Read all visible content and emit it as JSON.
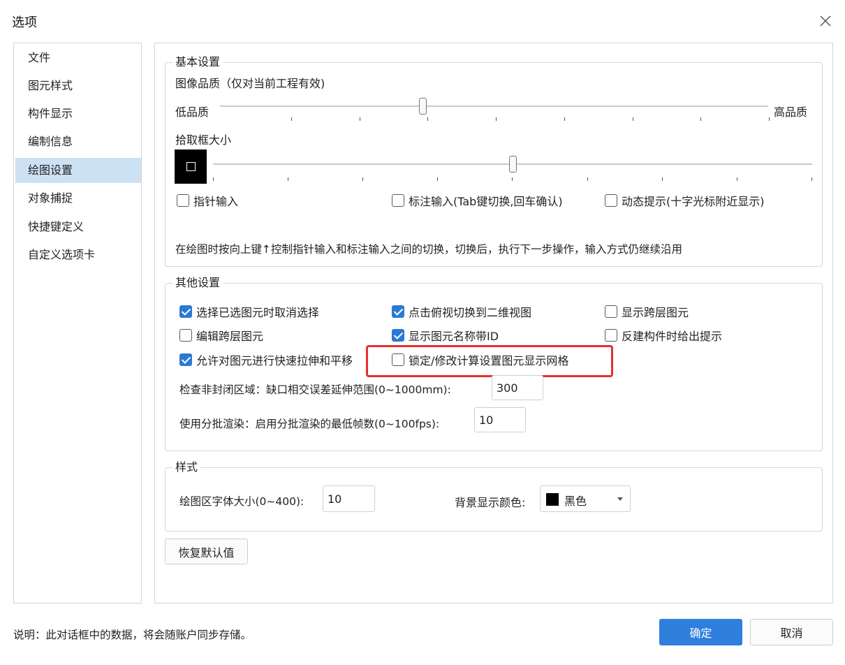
{
  "window": {
    "title": "选项"
  },
  "sidebar": {
    "items": [
      {
        "label": "文件"
      },
      {
        "label": "图元样式"
      },
      {
        "label": "构件显示"
      },
      {
        "label": "编制信息"
      },
      {
        "label": "绘图设置"
      },
      {
        "label": "对象捕捉"
      },
      {
        "label": "快捷键定义"
      },
      {
        "label": "自定义选项卡"
      }
    ]
  },
  "basic": {
    "legend": "基本设置",
    "quality_label": "图像品质（仅对当前工程有效)",
    "quality_low": "低品质",
    "quality_high": "高品质",
    "quality_value": 0.37,
    "pickbox_label": "拾取框大小",
    "pickbox_value": 0.5,
    "pointer_input": "指针输入",
    "dimension_input": "标注输入(Tab键切换,回车确认)",
    "dynamic_tip": "动态提示(十字光标附近显示)",
    "note": "在绘图时按向上键↑控制指针输入和标注输入之间的切换，切换后，执行下一步操作，输入方式仍继续沿用"
  },
  "other": {
    "legend": "其他设置",
    "opt_deselect": "选择已选图元时取消选择",
    "opt_click_2d": "点击俯视切换到二维视图",
    "opt_show_cross": "显示跨层图元",
    "opt_edit_cross": "编辑跨层图元",
    "opt_show_id": "显示图元名称带ID",
    "opt_reverse_tip": "反建构件时给出提示",
    "opt_stretch": "允许对图元进行快速拉伸和平移",
    "opt_lock_grid": "锁定/修改计算设置图元显示网格",
    "gap_label": "检查非封闭区域：缺口相交误差延伸范围(0~1000mm):",
    "gap_value": "300",
    "batch_label": "使用分批渲染：启用分批渲染的最低帧数(0~100fps):",
    "batch_value": "10"
  },
  "style": {
    "legend": "样式",
    "font_label": "绘图区字体大小(0~400):",
    "font_value": "10",
    "bg_label": "背景显示颜色:",
    "bg_value": "黑色",
    "bg_color": "#000000"
  },
  "buttons": {
    "restore": "恢复默认值",
    "ok": "确定",
    "cancel": "取消"
  },
  "footer": {
    "note": "说明：此对话框中的数据，将会随账户同步存储。"
  },
  "colors": {
    "accent": "#2f7fdc",
    "highlight": "#e53030",
    "sidebar_active": "#cde1f5"
  },
  "icons": {
    "close": "close-icon",
    "dropdown": "chevron-down-icon"
  }
}
